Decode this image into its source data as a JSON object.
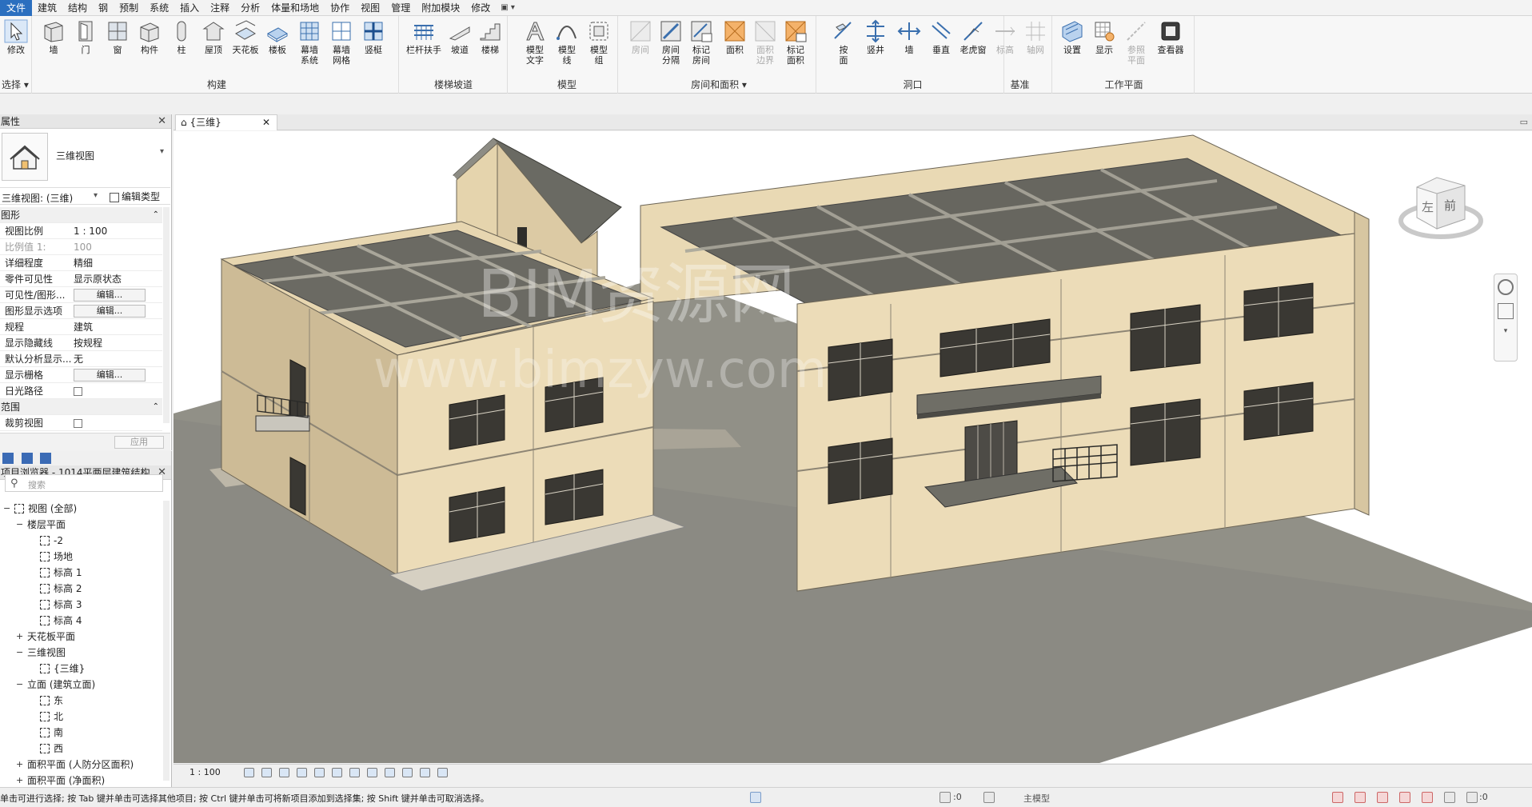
{
  "menu": {
    "file": "文件",
    "tabs": [
      "建筑",
      "结构",
      "钢",
      "预制",
      "系统",
      "插入",
      "注释",
      "分析",
      "体量和场地",
      "协作",
      "视图",
      "管理",
      "附加模块",
      "修改"
    ],
    "extra": "▣ ▾"
  },
  "ribbon": {
    "select_label": "选择",
    "modify_label": "修改",
    "groups": {
      "build": {
        "label": "构建",
        "buttons": [
          "墙",
          "门",
          "窗",
          "构件",
          "柱",
          "屋顶",
          "天花板",
          "楼板",
          "幕墙\n系统",
          "幕墙\n网格",
          "竖梃"
        ]
      },
      "stairs": {
        "label": "楼梯坡道",
        "buttons": [
          "栏杆扶手",
          "坡道",
          "楼梯"
        ]
      },
      "model": {
        "label": "模型",
        "buttons": [
          "模型\n文字",
          "模型\n线",
          "模型\n组"
        ]
      },
      "room": {
        "label": "房间和面积",
        "buttons": [
          "房间",
          "房间\n分隔",
          "标记\n房间",
          "面积",
          "面积\n边界",
          "标记\n面积"
        ]
      },
      "opening": {
        "label": "洞口",
        "buttons": [
          "按\n面",
          "竖井",
          "墙",
          "垂直",
          "老虎窗"
        ]
      },
      "datum": {
        "label": "基准",
        "buttons": [
          "标高",
          "轴网"
        ]
      },
      "workplane": {
        "label": "工作平面",
        "buttons": [
          "设置",
          "显示",
          "参照\n平面",
          "查看器"
        ]
      }
    }
  },
  "properties": {
    "title": "属性",
    "type_name": "三维视图",
    "view_selector": "三维视图: (三维)",
    "edit_type": "编辑类型",
    "sections": [
      {
        "name": "图形",
        "rows": [
          {
            "k": "视图比例",
            "v": "1 : 100"
          },
          {
            "k": "比例值 1:",
            "v": "100",
            "dim": true
          },
          {
            "k": "详细程度",
            "v": "精细"
          },
          {
            "k": "零件可见性",
            "v": "显示原状态"
          },
          {
            "k": "可见性/图形...",
            "v": "编辑...",
            "btn": true
          },
          {
            "k": "图形显示选项",
            "v": "编辑...",
            "btn": true
          },
          {
            "k": "规程",
            "v": "建筑"
          },
          {
            "k": "显示隐藏线",
            "v": "按规程"
          },
          {
            "k": "默认分析显示...",
            "v": "无"
          },
          {
            "k": "显示栅格",
            "v": "编辑...",
            "btn": true
          },
          {
            "k": "日光路径",
            "v": "",
            "check": true
          }
        ]
      },
      {
        "name": "范围",
        "rows": [
          {
            "k": "裁剪视图",
            "v": "",
            "check": true
          }
        ]
      }
    ],
    "apply": "应用"
  },
  "browser": {
    "title": "项目浏览器 - 1014平两层建筑结构...",
    "search_placeholder": "搜索",
    "tree": [
      {
        "label": "视图 (全部)",
        "level": 0,
        "toggle": "−",
        "icon": true
      },
      {
        "label": "楼层平面",
        "level": 1,
        "toggle": "−"
      },
      {
        "label": "-2",
        "level": 2,
        "icon": true
      },
      {
        "label": "场地",
        "level": 2,
        "icon": true
      },
      {
        "label": "标高 1",
        "level": 2,
        "icon": true
      },
      {
        "label": "标高 2",
        "level": 2,
        "icon": true
      },
      {
        "label": "标高 3",
        "level": 2,
        "icon": true
      },
      {
        "label": "标高 4",
        "level": 2,
        "icon": true
      },
      {
        "label": "天花板平面",
        "level": 1,
        "toggle": "+"
      },
      {
        "label": "三维视图",
        "level": 1,
        "toggle": "−"
      },
      {
        "label": "{三维}",
        "level": 2,
        "icon": true
      },
      {
        "label": "立面 (建筑立面)",
        "level": 1,
        "toggle": "−"
      },
      {
        "label": "东",
        "level": 2,
        "icon": true
      },
      {
        "label": "北",
        "level": 2,
        "icon": true
      },
      {
        "label": "南",
        "level": 2,
        "icon": true
      },
      {
        "label": "西",
        "level": 2,
        "icon": true
      },
      {
        "label": "面积平面 (人防分区面积)",
        "level": 1,
        "toggle": "+"
      },
      {
        "label": "面积平面 (净面积)",
        "level": 1,
        "toggle": "+"
      }
    ]
  },
  "view": {
    "tab_label": "{三维}",
    "scale": "1 : 100",
    "viewcube_left": "左",
    "viewcube_front": "前",
    "watermark1": "BIM资源网",
    "watermark2": "www.bimzyw.com"
  },
  "status": {
    "message": "单击可进行选择; 按 Tab 键并单击可选择其他项目; 按 Ctrl 键并单击可将新项目添加到选择集; 按 Shift 键并单击可取消选择。",
    "zero1": ":0",
    "model": "主模型",
    "zero2": ":0"
  },
  "colors": {
    "wall": "#ecdcb8",
    "wall_shade": "#cdbb96",
    "roof": "#6f6f6a",
    "ground": "#8a8a82",
    "accent": "#2b6fbf"
  }
}
